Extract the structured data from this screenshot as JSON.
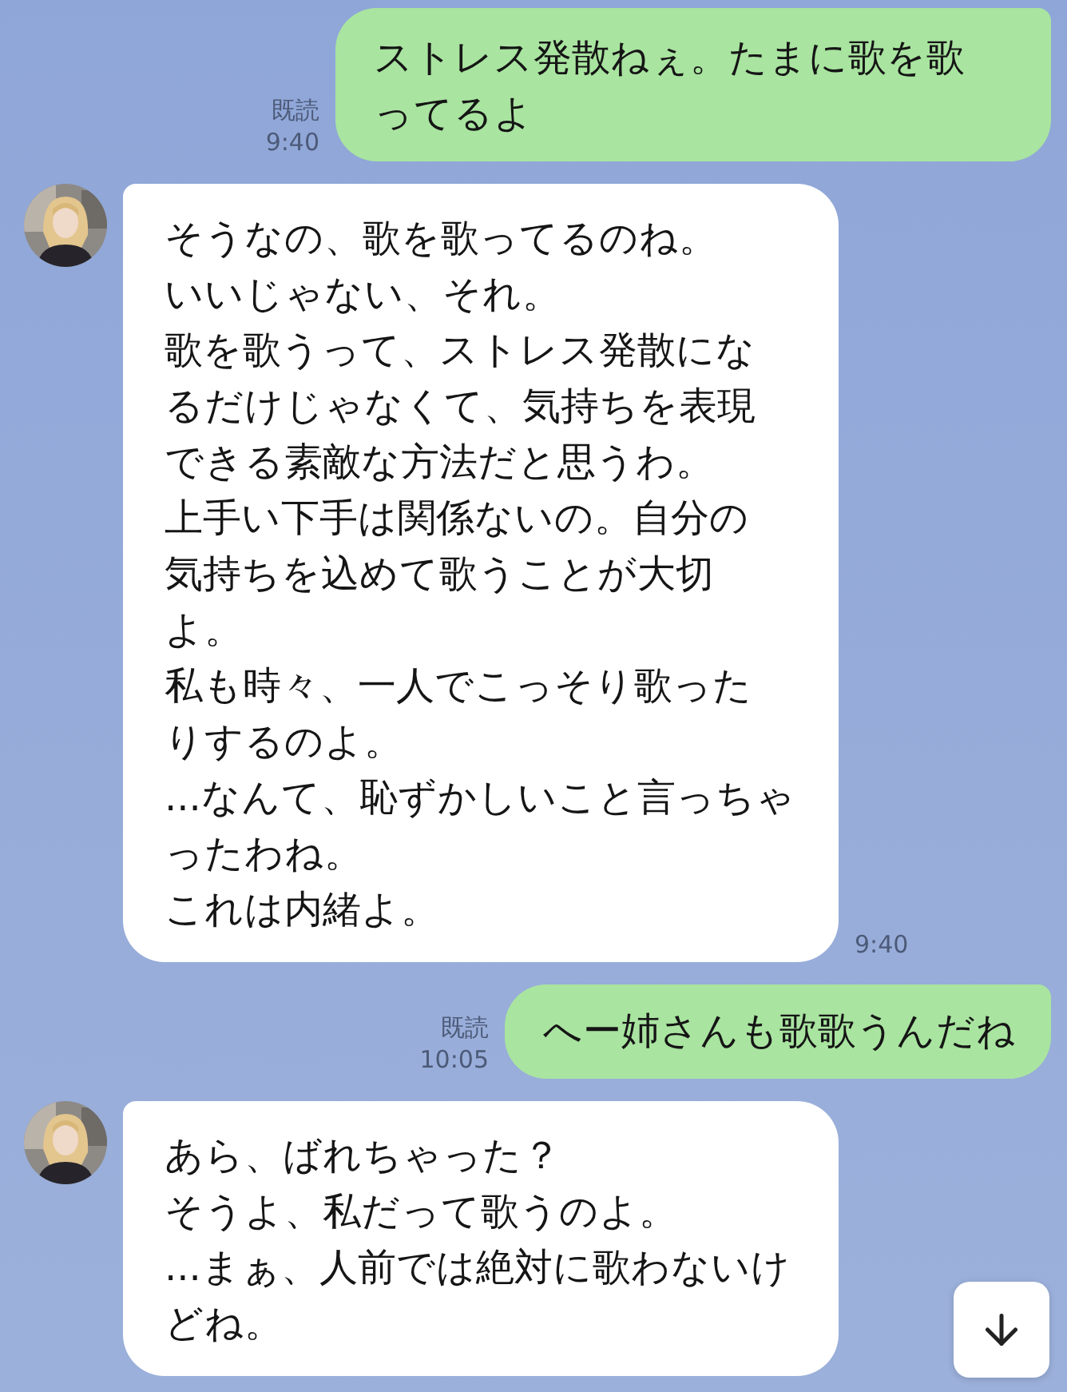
{
  "messages": [
    {
      "kind": "sent",
      "lines": [
        "ストレス発散ねぇ。たまに歌を歌",
        "ってるよ"
      ],
      "read": "既読",
      "time": "9:40"
    },
    {
      "kind": "received",
      "lines": [
        "そうなの、歌を歌ってるのね。",
        "いいじゃない、それ。",
        "歌を歌うって、ストレス発散にな",
        "るだけじゃなくて、気持ちを表現",
        "できる素敵な方法だと思うわ。",
        "上手い下手は関係ないの。自分の",
        "気持ちを込めて歌うことが大切",
        "よ。",
        "私も時々、一人でこっそり歌った",
        "りするのよ。",
        "...なんて、恥ずかしいこと言っちゃ",
        "ったわね。",
        "これは内緒よ。"
      ],
      "time": "9:40"
    },
    {
      "kind": "sent",
      "lines": [
        "へー姉さんも歌歌うんだね"
      ],
      "read": "既読",
      "time": "10:05"
    },
    {
      "kind": "received",
      "lines": [
        "あら、ばれちゃった？",
        "そうよ、私だって歌うのよ。",
        "...まぁ、人前では絶対に歌わないけ",
        "どね。"
      ]
    }
  ]
}
